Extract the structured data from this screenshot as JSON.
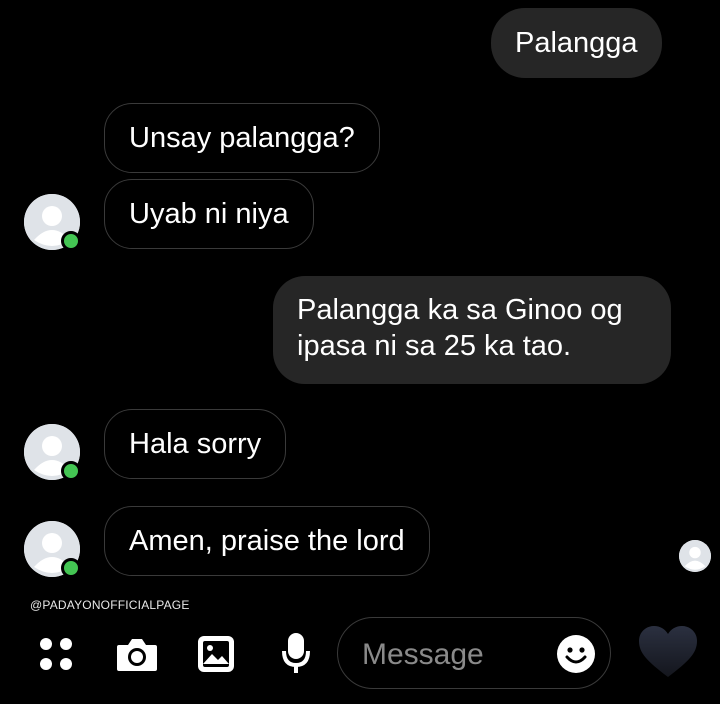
{
  "messages": [
    {
      "id": "m1",
      "text": "Palangga"
    },
    {
      "id": "m2",
      "text": "Unsay palangga?"
    },
    {
      "id": "m3",
      "text": "Uyab ni niya"
    },
    {
      "id": "m4",
      "text": "Palangga ka sa Ginoo og ipasa ni sa 25 ka tao."
    },
    {
      "id": "m5",
      "text": "Hala sorry"
    },
    {
      "id": "m6",
      "text": "Amen, praise the lord"
    }
  ],
  "watermark": "@PADAYONOFFICIALPAGE",
  "composer": {
    "placeholder": "Message",
    "icons": [
      "menu-dots-icon",
      "camera-icon",
      "gallery-icon",
      "microphone-icon",
      "emoji-icon",
      "heart-icon"
    ]
  },
  "colors": {
    "online": "#44c553",
    "outgoing_bubble": "#262626",
    "incoming_border": "#3a3a3a"
  }
}
